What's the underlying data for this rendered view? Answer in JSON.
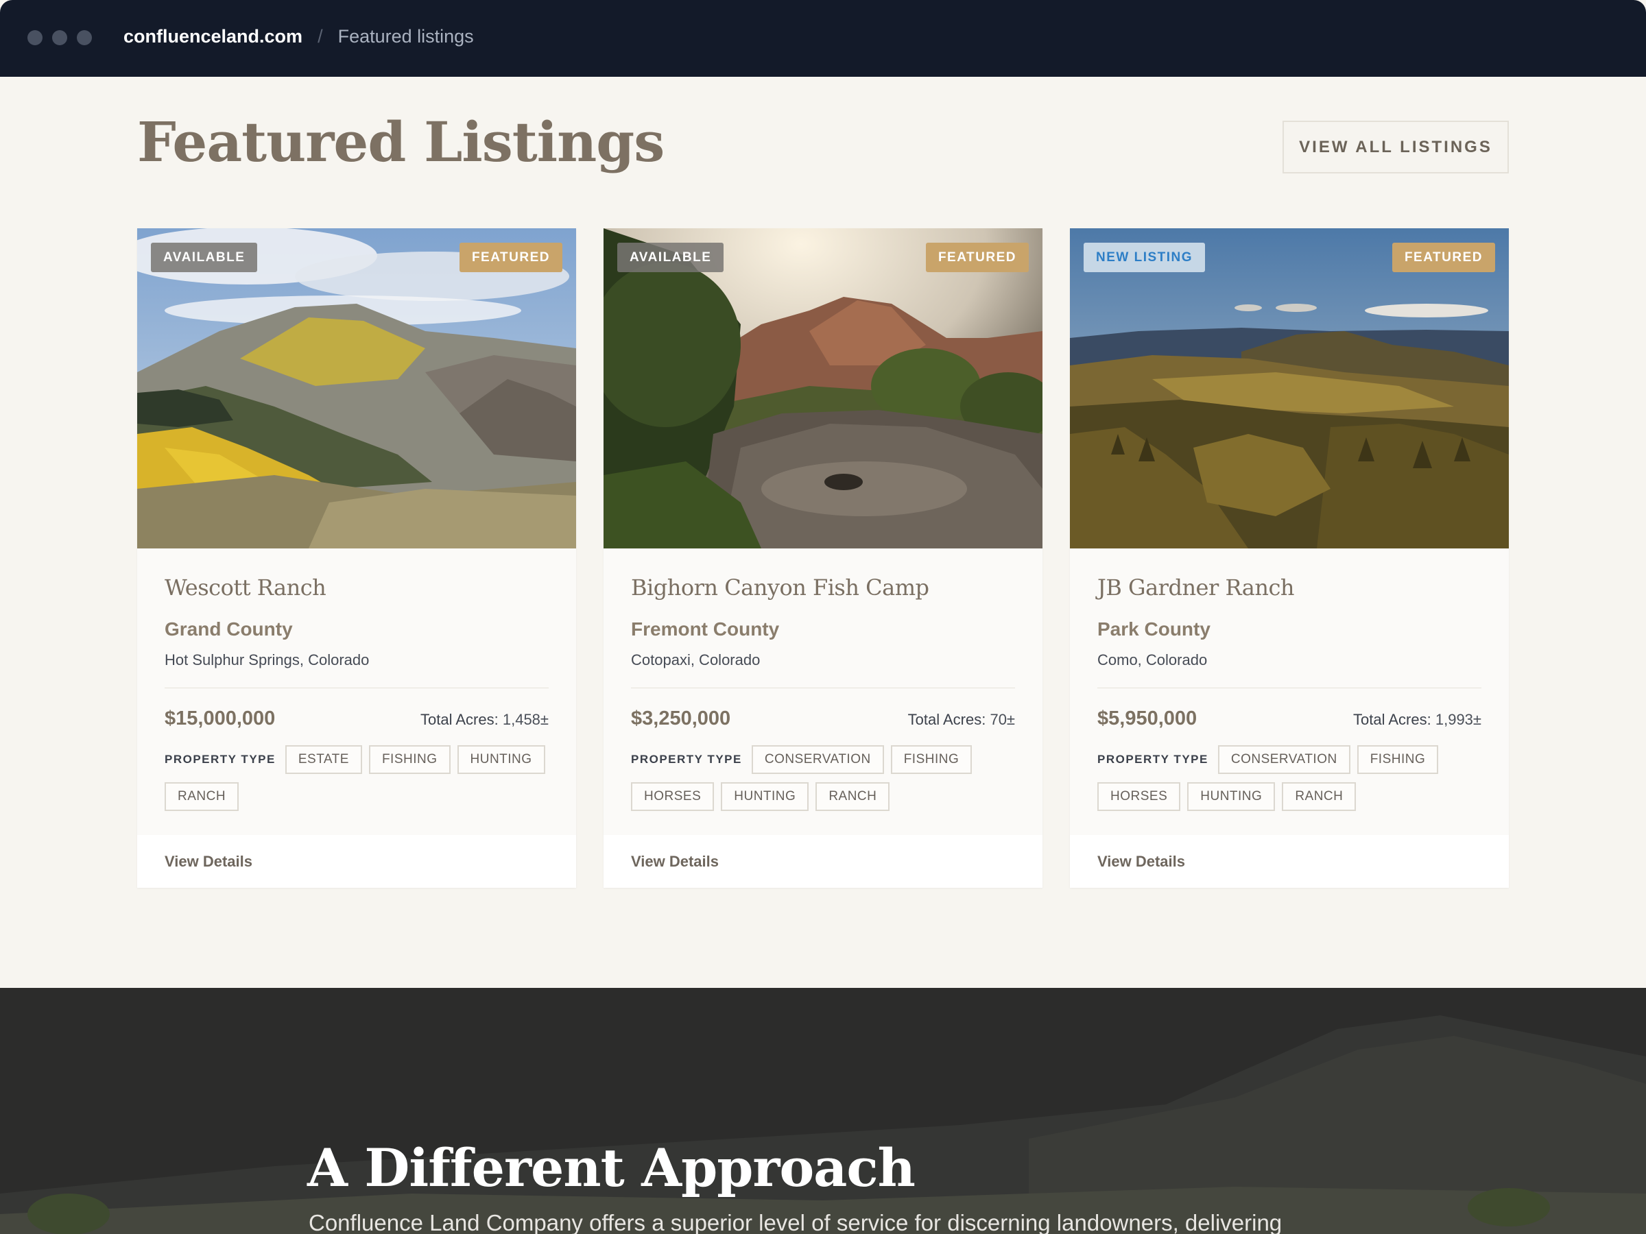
{
  "browser": {
    "domain": "confluenceland.com",
    "separator": "/",
    "page": "Featured listings"
  },
  "header": {
    "title": "Featured Listings",
    "view_all_label": "VIEW ALL LISTINGS"
  },
  "property_type_label": "PROPERTY TYPE",
  "total_acres_label": "Total Acres:",
  "view_details_label": "View Details",
  "listings": [
    {
      "status_badge": "AVAILABLE",
      "featured_badge": "FEATURED",
      "name": "Wescott Ranch",
      "county": "Grand County",
      "location": "Hot Sulphur Springs, Colorado",
      "price": "$15,000,000",
      "acres": "1,458±",
      "tags": [
        "ESTATE",
        "FISHING",
        "HUNTING",
        "RANCH"
      ]
    },
    {
      "status_badge": "AVAILABLE",
      "featured_badge": "FEATURED",
      "name": "Bighorn Canyon Fish Camp",
      "county": "Fremont County",
      "location": "Cotopaxi, Colorado",
      "price": "$3,250,000",
      "acres": "70±",
      "tags": [
        "CONSERVATION",
        "FISHING",
        "HORSES",
        "HUNTING",
        "RANCH"
      ]
    },
    {
      "status_badge": "NEW LISTING",
      "featured_badge": "FEATURED",
      "name": "JB Gardner Ranch",
      "county": "Park County",
      "location": "Como, Colorado",
      "price": "$5,950,000",
      "acres": "1,993±",
      "tags": [
        "CONSERVATION",
        "FISHING",
        "HORSES",
        "HUNTING",
        "RANCH"
      ]
    }
  ],
  "approach": {
    "title": "A Different Approach",
    "text": "Confluence Land Company offers a superior level of service for discerning landowners, delivering"
  },
  "colors": {
    "topbar": "#131a29",
    "accent_gold": "#c9a46a",
    "heading_brown": "#7d7163",
    "new_listing_blue": "#2d7ec6"
  }
}
